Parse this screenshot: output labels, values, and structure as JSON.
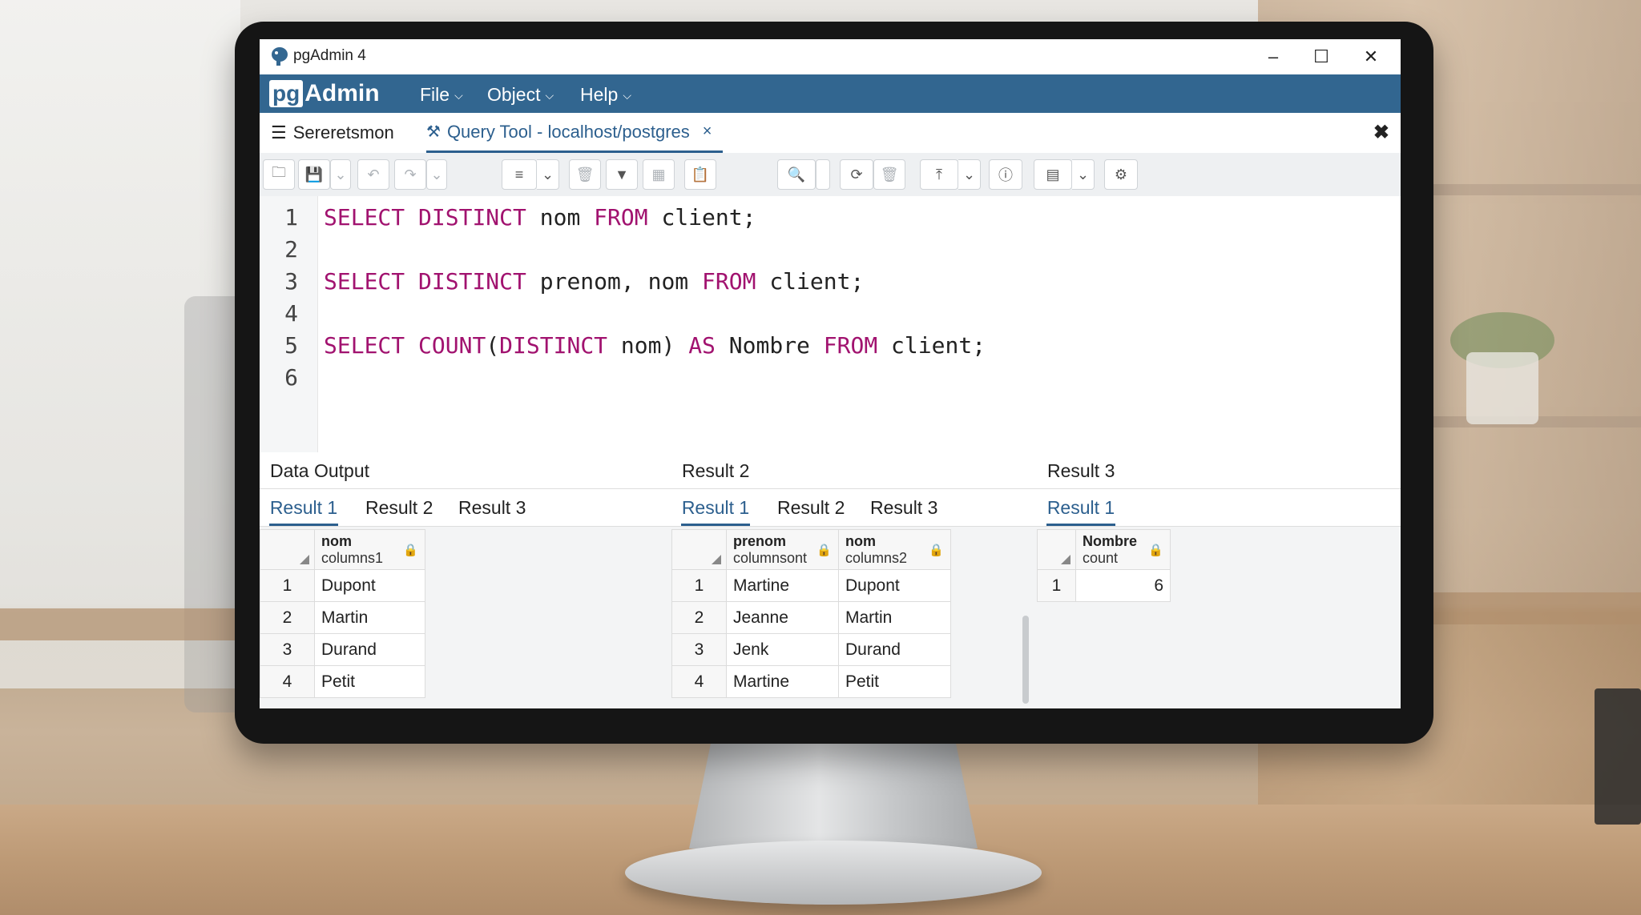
{
  "window": {
    "title": "pgAdmin 4",
    "minimize": "–",
    "maximize": "☐",
    "close": "✕"
  },
  "menubar": {
    "logo_pg": "pg",
    "logo_admin": "Admin",
    "items": [
      {
        "label": "File"
      },
      {
        "label": "Object"
      },
      {
        "label": "Help"
      }
    ]
  },
  "tabs": [
    {
      "label": "Sereretsmon"
    },
    {
      "label": "Query Tool - localhost/postgres",
      "close": "×"
    }
  ],
  "editor": {
    "line_numbers": [
      "1",
      "2",
      "3",
      "4",
      "5",
      "6"
    ],
    "lines": [
      {
        "k1": "SELECT",
        "k2": "DISTINCT",
        "t1": " nom ",
        "k3": "FROM",
        "t2": " client;"
      },
      {
        "k1": "SELECT",
        "k2": "DISTINCT",
        "t1": " prenom, nom ",
        "k3": "FROM",
        "t2": " client;"
      },
      {
        "k1": "SELECT",
        "k2": "COUNT",
        "t0": "(",
        "k2b": "DISTINCT",
        "t1": " nom) ",
        "k3": "AS",
        "t2": " Nombre ",
        "k4": "FROM",
        "t3": " client;"
      }
    ]
  },
  "panes": [
    {
      "title": "Data Output",
      "tabs": [
        "Result 1",
        "Result 2",
        "Result 3"
      ],
      "columns": [
        {
          "name": "nom",
          "type": "columns1"
        }
      ],
      "rows": [
        [
          "1",
          "Dupont"
        ],
        [
          "2",
          "Martin"
        ],
        [
          "3",
          "Durand"
        ],
        [
          "4",
          "Petit"
        ]
      ]
    },
    {
      "title": "Result 2",
      "tabs": [
        "Result 1",
        "Result 2",
        "Result 3"
      ],
      "columns": [
        {
          "name": "prenom",
          "type": "columnsont"
        },
        {
          "name": "nom",
          "type": "columns2"
        }
      ],
      "rows": [
        [
          "1",
          "Martine",
          "Dupont"
        ],
        [
          "2",
          "Jeanne",
          "Martin"
        ],
        [
          "3",
          "Jenk",
          "Durand"
        ],
        [
          "4",
          "Martine",
          "Petit"
        ]
      ]
    },
    {
      "title": "Result 3",
      "tabs": [
        "Result 1"
      ],
      "columns": [
        {
          "name": "Nombre",
          "type": "count"
        }
      ],
      "rows": [
        [
          "1",
          "6"
        ]
      ]
    }
  ],
  "colors": {
    "accent": "#326690",
    "keyword": "#a1126f",
    "active_tab": "#2c5f8e"
  }
}
